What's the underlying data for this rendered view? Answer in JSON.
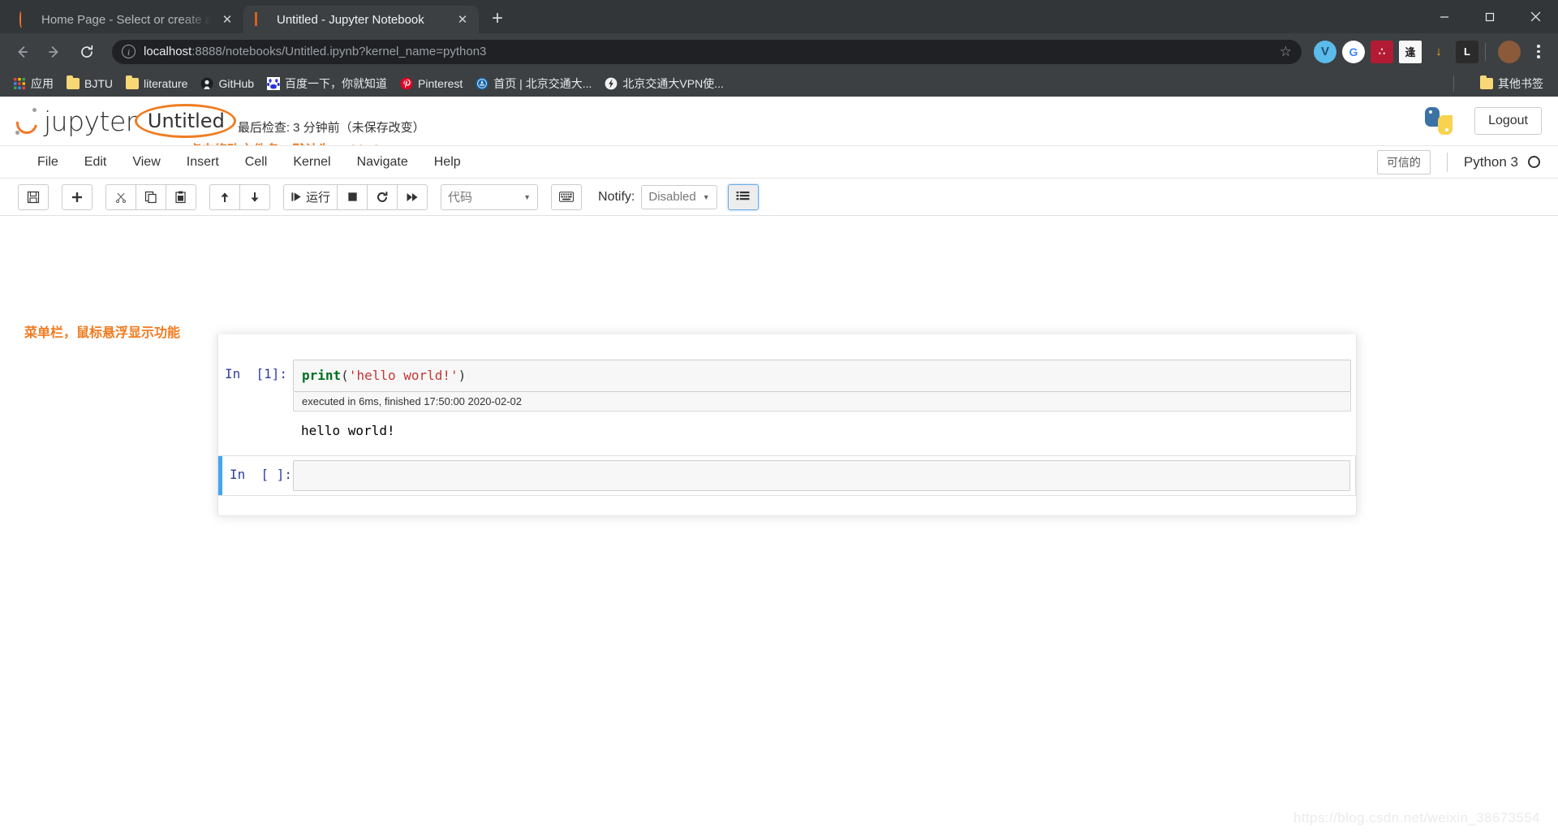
{
  "browser": {
    "tabs": [
      {
        "title": "Home Page - Select or create a",
        "favicon": "jupyter-spinner-icon",
        "active": false
      },
      {
        "title": "Untitled - Jupyter Notebook",
        "favicon": "jupyter-book-icon",
        "active": true
      }
    ],
    "new_tab_label": "+",
    "window_controls": {
      "minimize": "—",
      "maximize": "☐",
      "close": "✕"
    },
    "nav": {
      "back": "←",
      "forward": "→",
      "reload": "⟳"
    },
    "omnibox": {
      "host": "localhost",
      "rest": ":8888/notebooks/Untitled.ipynb?kernel_name=python3",
      "full_url": "localhost:8888/notebooks/Untitled.ipynb?kernel_name=python3",
      "info_icon": "site-info-icon",
      "star_icon": "bookmark-star-icon"
    },
    "extensions": [
      {
        "name": "v-extension-icon",
        "glyph": "V",
        "bg": "#5bbbea",
        "fg": "#1b4f72"
      },
      {
        "name": "google-translate-icon",
        "glyph": "G",
        "bg": "#ffffff",
        "fg": "#4285f4"
      },
      {
        "name": "red-extension-icon",
        "glyph": "∴",
        "bg": "#b31b34",
        "fg": "#ffffff"
      },
      {
        "name": "seal-extension-icon",
        "glyph": "逢",
        "bg": "#f7f7f7",
        "fg": "#222222"
      },
      {
        "name": "download-helper-icon",
        "glyph": "↓",
        "bg": "#3c4043",
        "fg": "#f4b400"
      },
      {
        "name": "l-extension-icon",
        "glyph": "L",
        "bg": "#2b2b2b",
        "fg": "#ffffff"
      }
    ],
    "avatar_name": "profile-avatar",
    "menu_name": "chrome-menu-icon",
    "bookmarks": [
      {
        "label": "应用",
        "icon": "apps-grid-icon"
      },
      {
        "label": "BJTU",
        "icon": "folder-icon"
      },
      {
        "label": "literature",
        "icon": "folder-icon"
      },
      {
        "label": "GitHub",
        "icon": "github-icon"
      },
      {
        "label": "百度一下，你就知道",
        "icon": "baidu-icon"
      },
      {
        "label": "Pinterest",
        "icon": "pinterest-icon"
      },
      {
        "label": "首页 | 北京交通大...",
        "icon": "bjtu-icon"
      },
      {
        "label": "北京交通大VPN使...",
        "icon": "vpn-icon"
      }
    ],
    "other_bookmarks": {
      "label": "其他书签",
      "icon": "folder-icon"
    }
  },
  "jupyter": {
    "brand": "jupyter",
    "notebook_name": "Untitled",
    "checkpoint": "最后检查: 3 分钟前（未保存改变）",
    "logout_label": "Logout",
    "python_logo_name": "python-logo",
    "menu": [
      "File",
      "Edit",
      "View",
      "Insert",
      "Cell",
      "Kernel",
      "Navigate",
      "Help"
    ],
    "trust_badge": "可信的",
    "kernel_name": "Python 3",
    "kernel_status": "idle-circle-icon",
    "toolbar": {
      "groups": [
        [
          {
            "name": "save-button",
            "icon": "floppy-disk-icon",
            "label": ""
          }
        ],
        [
          {
            "name": "insert-cell-below-button",
            "icon": "plus-icon",
            "label": ""
          }
        ],
        [
          {
            "name": "cut-cell-button",
            "icon": "scissors-icon",
            "label": ""
          },
          {
            "name": "copy-cell-button",
            "icon": "copy-icon",
            "label": ""
          },
          {
            "name": "paste-cell-button",
            "icon": "paste-icon",
            "label": ""
          }
        ],
        [
          {
            "name": "move-cell-up-button",
            "icon": "arrow-up-icon",
            "label": ""
          },
          {
            "name": "move-cell-down-button",
            "icon": "arrow-down-icon",
            "label": ""
          }
        ],
        [
          {
            "name": "run-cell-button",
            "icon": "run-icon",
            "label": "运行"
          },
          {
            "name": "interrupt-kernel-button",
            "icon": "stop-square-icon",
            "label": ""
          },
          {
            "name": "restart-kernel-button",
            "icon": "restart-icon",
            "label": ""
          },
          {
            "name": "restart-and-run-all-button",
            "icon": "fast-forward-icon",
            "label": ""
          }
        ]
      ],
      "cell_type": {
        "value": "代码",
        "caret": "▼"
      },
      "keyboard_button": {
        "name": "command-palette-button",
        "icon": "keyboard-icon"
      },
      "notify_label": "Notify:",
      "notify_value": "Disabled",
      "notify_caret": "▼",
      "toc_button": {
        "name": "table-of-contents-button",
        "icon": "list-lines-icon"
      }
    },
    "cells": [
      {
        "prompt": "In  [1]:",
        "code_tokens": [
          {
            "text": "print",
            "type": "fn"
          },
          {
            "text": "(",
            "type": "par"
          },
          {
            "text": "'hello world!'",
            "type": "str"
          },
          {
            "text": ")",
            "type": "par"
          }
        ],
        "exec_info": "executed in 6ms, finished 17:50:00 2020-02-02",
        "output": "hello world!",
        "selected": false
      },
      {
        "prompt": "In  [ ]:",
        "code_tokens": [],
        "exec_info": "",
        "output": "",
        "selected": true
      }
    ]
  },
  "annotations": {
    "name_hint": "点击修改文件名，默认为untitled",
    "toolbar_hint": "菜单栏，鼠标悬浮显示功能",
    "accent_color": "#f07c21"
  },
  "watermark": "https://blog.csdn.net/weixin_38673554"
}
